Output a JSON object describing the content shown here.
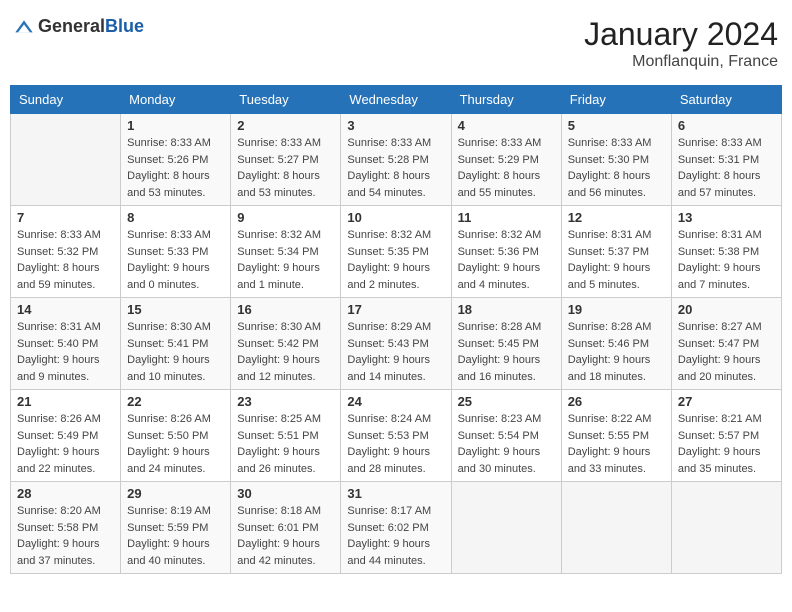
{
  "header": {
    "logo_general": "General",
    "logo_blue": "Blue",
    "month_year": "January 2024",
    "location": "Monflanquin, France"
  },
  "days_of_week": [
    "Sunday",
    "Monday",
    "Tuesday",
    "Wednesday",
    "Thursday",
    "Friday",
    "Saturday"
  ],
  "weeks": [
    [
      {
        "day": "",
        "sunrise": "",
        "sunset": "",
        "daylight": "",
        "empty": true
      },
      {
        "day": "1",
        "sunrise": "Sunrise: 8:33 AM",
        "sunset": "Sunset: 5:26 PM",
        "daylight": "Daylight: 8 hours and 53 minutes."
      },
      {
        "day": "2",
        "sunrise": "Sunrise: 8:33 AM",
        "sunset": "Sunset: 5:27 PM",
        "daylight": "Daylight: 8 hours and 53 minutes."
      },
      {
        "day": "3",
        "sunrise": "Sunrise: 8:33 AM",
        "sunset": "Sunset: 5:28 PM",
        "daylight": "Daylight: 8 hours and 54 minutes."
      },
      {
        "day": "4",
        "sunrise": "Sunrise: 8:33 AM",
        "sunset": "Sunset: 5:29 PM",
        "daylight": "Daylight: 8 hours and 55 minutes."
      },
      {
        "day": "5",
        "sunrise": "Sunrise: 8:33 AM",
        "sunset": "Sunset: 5:30 PM",
        "daylight": "Daylight: 8 hours and 56 minutes."
      },
      {
        "day": "6",
        "sunrise": "Sunrise: 8:33 AM",
        "sunset": "Sunset: 5:31 PM",
        "daylight": "Daylight: 8 hours and 57 minutes."
      }
    ],
    [
      {
        "day": "7",
        "sunrise": "Sunrise: 8:33 AM",
        "sunset": "Sunset: 5:32 PM",
        "daylight": "Daylight: 8 hours and 59 minutes."
      },
      {
        "day": "8",
        "sunrise": "Sunrise: 8:33 AM",
        "sunset": "Sunset: 5:33 PM",
        "daylight": "Daylight: 9 hours and 0 minutes."
      },
      {
        "day": "9",
        "sunrise": "Sunrise: 8:32 AM",
        "sunset": "Sunset: 5:34 PM",
        "daylight": "Daylight: 9 hours and 1 minute."
      },
      {
        "day": "10",
        "sunrise": "Sunrise: 8:32 AM",
        "sunset": "Sunset: 5:35 PM",
        "daylight": "Daylight: 9 hours and 2 minutes."
      },
      {
        "day": "11",
        "sunrise": "Sunrise: 8:32 AM",
        "sunset": "Sunset: 5:36 PM",
        "daylight": "Daylight: 9 hours and 4 minutes."
      },
      {
        "day": "12",
        "sunrise": "Sunrise: 8:31 AM",
        "sunset": "Sunset: 5:37 PM",
        "daylight": "Daylight: 9 hours and 5 minutes."
      },
      {
        "day": "13",
        "sunrise": "Sunrise: 8:31 AM",
        "sunset": "Sunset: 5:38 PM",
        "daylight": "Daylight: 9 hours and 7 minutes."
      }
    ],
    [
      {
        "day": "14",
        "sunrise": "Sunrise: 8:31 AM",
        "sunset": "Sunset: 5:40 PM",
        "daylight": "Daylight: 9 hours and 9 minutes."
      },
      {
        "day": "15",
        "sunrise": "Sunrise: 8:30 AM",
        "sunset": "Sunset: 5:41 PM",
        "daylight": "Daylight: 9 hours and 10 minutes."
      },
      {
        "day": "16",
        "sunrise": "Sunrise: 8:30 AM",
        "sunset": "Sunset: 5:42 PM",
        "daylight": "Daylight: 9 hours and 12 minutes."
      },
      {
        "day": "17",
        "sunrise": "Sunrise: 8:29 AM",
        "sunset": "Sunset: 5:43 PM",
        "daylight": "Daylight: 9 hours and 14 minutes."
      },
      {
        "day": "18",
        "sunrise": "Sunrise: 8:28 AM",
        "sunset": "Sunset: 5:45 PM",
        "daylight": "Daylight: 9 hours and 16 minutes."
      },
      {
        "day": "19",
        "sunrise": "Sunrise: 8:28 AM",
        "sunset": "Sunset: 5:46 PM",
        "daylight": "Daylight: 9 hours and 18 minutes."
      },
      {
        "day": "20",
        "sunrise": "Sunrise: 8:27 AM",
        "sunset": "Sunset: 5:47 PM",
        "daylight": "Daylight: 9 hours and 20 minutes."
      }
    ],
    [
      {
        "day": "21",
        "sunrise": "Sunrise: 8:26 AM",
        "sunset": "Sunset: 5:49 PM",
        "daylight": "Daylight: 9 hours and 22 minutes."
      },
      {
        "day": "22",
        "sunrise": "Sunrise: 8:26 AM",
        "sunset": "Sunset: 5:50 PM",
        "daylight": "Daylight: 9 hours and 24 minutes."
      },
      {
        "day": "23",
        "sunrise": "Sunrise: 8:25 AM",
        "sunset": "Sunset: 5:51 PM",
        "daylight": "Daylight: 9 hours and 26 minutes."
      },
      {
        "day": "24",
        "sunrise": "Sunrise: 8:24 AM",
        "sunset": "Sunset: 5:53 PM",
        "daylight": "Daylight: 9 hours and 28 minutes."
      },
      {
        "day": "25",
        "sunrise": "Sunrise: 8:23 AM",
        "sunset": "Sunset: 5:54 PM",
        "daylight": "Daylight: 9 hours and 30 minutes."
      },
      {
        "day": "26",
        "sunrise": "Sunrise: 8:22 AM",
        "sunset": "Sunset: 5:55 PM",
        "daylight": "Daylight: 9 hours and 33 minutes."
      },
      {
        "day": "27",
        "sunrise": "Sunrise: 8:21 AM",
        "sunset": "Sunset: 5:57 PM",
        "daylight": "Daylight: 9 hours and 35 minutes."
      }
    ],
    [
      {
        "day": "28",
        "sunrise": "Sunrise: 8:20 AM",
        "sunset": "Sunset: 5:58 PM",
        "daylight": "Daylight: 9 hours and 37 minutes."
      },
      {
        "day": "29",
        "sunrise": "Sunrise: 8:19 AM",
        "sunset": "Sunset: 5:59 PM",
        "daylight": "Daylight: 9 hours and 40 minutes."
      },
      {
        "day": "30",
        "sunrise": "Sunrise: 8:18 AM",
        "sunset": "Sunset: 6:01 PM",
        "daylight": "Daylight: 9 hours and 42 minutes."
      },
      {
        "day": "31",
        "sunrise": "Sunrise: 8:17 AM",
        "sunset": "Sunset: 6:02 PM",
        "daylight": "Daylight: 9 hours and 44 minutes."
      },
      {
        "day": "",
        "sunrise": "",
        "sunset": "",
        "daylight": "",
        "empty": true
      },
      {
        "day": "",
        "sunrise": "",
        "sunset": "",
        "daylight": "",
        "empty": true
      },
      {
        "day": "",
        "sunrise": "",
        "sunset": "",
        "daylight": "",
        "empty": true
      }
    ]
  ]
}
